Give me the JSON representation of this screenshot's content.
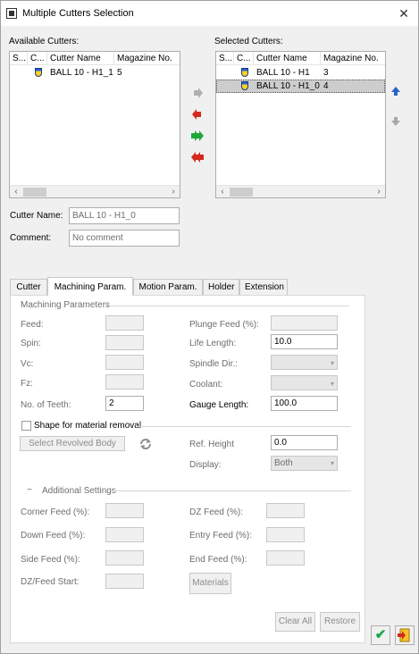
{
  "window": {
    "title": "Multiple Cutters Selection",
    "close_glyph": "✕"
  },
  "available": {
    "label": "Available Cutters:",
    "columns": [
      "S...",
      "C...",
      "Cutter Name",
      "Magazine No."
    ],
    "rows": [
      {
        "name": "BALL 10 - H1_1",
        "magazine": "5"
      }
    ]
  },
  "selected": {
    "label": "Selected Cutters:",
    "columns": [
      "S...",
      "C...",
      "Cutter Name",
      "Magazine No."
    ],
    "rows": [
      {
        "name": "BALL 10 - H1",
        "magazine": "3"
      },
      {
        "name": "BALL 10 - H1_0",
        "magazine": "4"
      }
    ]
  },
  "cutter_name": {
    "label": "Cutter Name:",
    "value": "BALL 10 - H1_0"
  },
  "comment": {
    "label": "Comment:",
    "value": "No comment"
  },
  "tabs": [
    "Cutter",
    "Machining Param.",
    "Motion Param.",
    "Holder",
    "Extension"
  ],
  "machining": {
    "group_label": "Machining Parameters",
    "feed_label": "Feed:",
    "spin_label": "Spin:",
    "vc_label": "Vc:",
    "fz_label": "Fz:",
    "teeth_label": "No. of Teeth:",
    "teeth_value": "2",
    "plunge_label": "Plunge Feed (%):",
    "life_label": "Life Length:",
    "life_value": "10.0",
    "spindle_label": "Spindle Dir.:",
    "coolant_label": "Coolant:",
    "gauge_label": "Gauge Length:",
    "gauge_value": "100.0"
  },
  "shape": {
    "checkbox_label": "Shape for material removal",
    "select_button": "Select Revolved Body",
    "ref_height_label": "Ref. Height",
    "ref_height_value": "0.0",
    "display_label": "Display:",
    "display_value": "Both"
  },
  "additional": {
    "group_label": "Additional Settings",
    "collapse_glyph": "−",
    "corner_feed": "Corner Feed (%):",
    "down_feed": "Down Feed (%):",
    "side_feed": "Side Feed (%):",
    "dz_feed_start": "DZ/Feed Start:",
    "dz_feed": "DZ Feed (%):",
    "entry_feed": "Entry Feed (%):",
    "end_feed": "End Feed (%):",
    "materials_button": "Materials"
  },
  "buttons": {
    "clear_all": "Clear All",
    "restore": "Restore",
    "ok_glyph": "✔"
  },
  "colors": {
    "accent": "#2a62c9",
    "ok_green": "#18a84a",
    "move_red": "#d42a1c",
    "move_green": "#1fa83a",
    "selection": "#cdcdcd"
  }
}
